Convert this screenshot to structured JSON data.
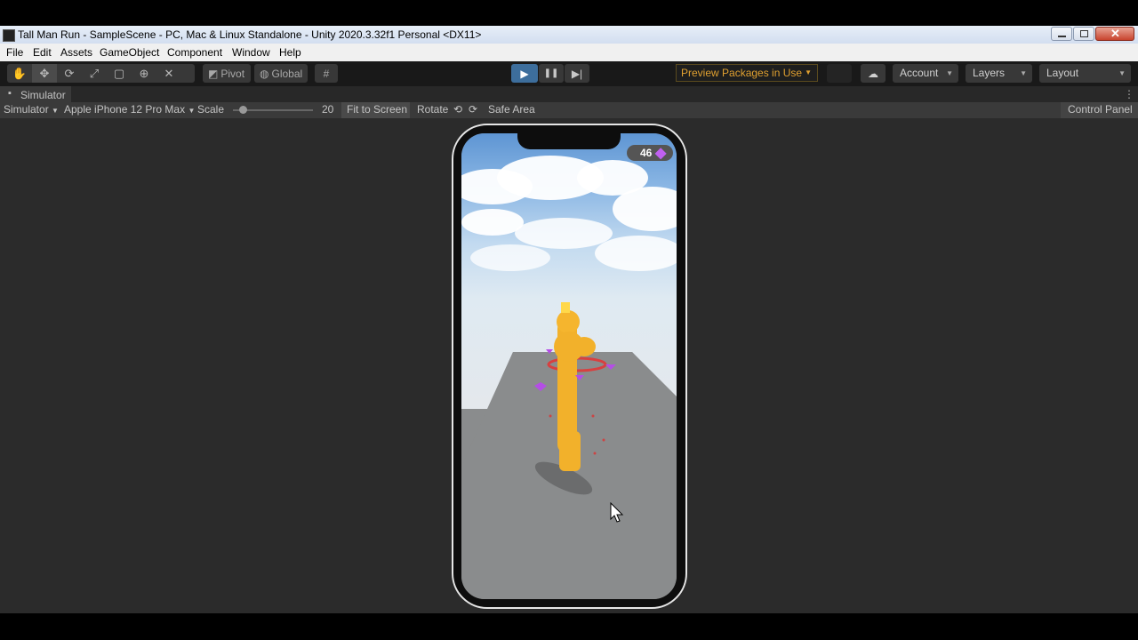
{
  "window": {
    "title": "Tall Man Run - SampleScene - PC, Mac & Linux Standalone - Unity 2020.3.32f1 Personal <DX11>"
  },
  "menu": [
    "File",
    "Edit",
    "Assets",
    "GameObject",
    "Component",
    "Window",
    "Help"
  ],
  "toolbar": {
    "tools": [
      "hand-tool-icon",
      "move-tool-icon",
      "rotate-tool-icon",
      "scale-tool-icon",
      "rect-tool-icon",
      "transform-tool-icon",
      "custom-tool-icon"
    ],
    "pivot_label": "Pivot",
    "global_label": "Global",
    "preview_packages": "Preview Packages in Use",
    "account": "Account",
    "layers": "Layers",
    "layout": "Layout",
    "play_active": true
  },
  "simulator": {
    "tab_title": "Simulator",
    "mode": "Simulator",
    "device": "Apple iPhone 12 Pro Max",
    "scale_label": "Scale",
    "scale_value": "20",
    "fit_to_screen": "Fit to Screen",
    "rotate_label": "Rotate",
    "safe_area": "Safe Area",
    "control_panel": "Control Panel"
  },
  "game": {
    "gem_count": "46",
    "gem_color": "#b44ee6"
  },
  "colors": {
    "accent_play": "#3d6e9c",
    "warning": "#e0a030",
    "character": "#f2b12b"
  }
}
